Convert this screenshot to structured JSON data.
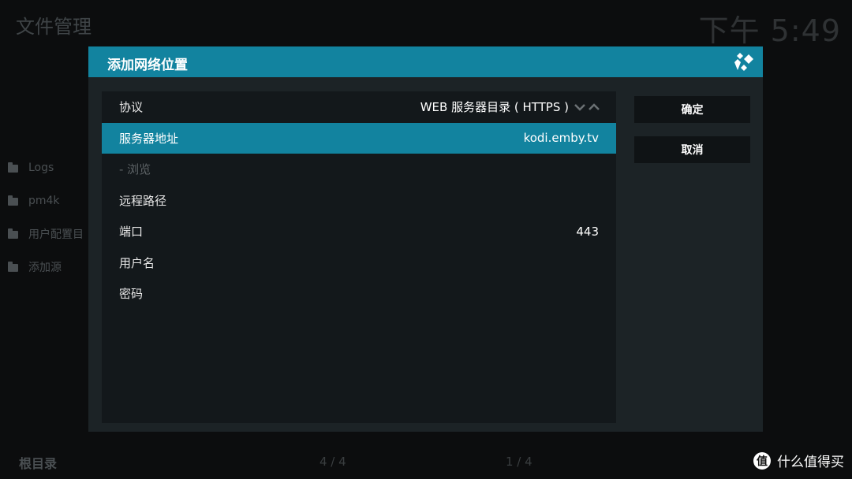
{
  "background": {
    "title": "文件管理",
    "clock": "下午 5:49",
    "sources": [
      {
        "label": "Logs"
      },
      {
        "label": "pm4k"
      },
      {
        "label": "用户配置目"
      },
      {
        "label": "添加源"
      }
    ],
    "footer_left": "根目录",
    "count_left": "4 / 4",
    "count_right": "1 / 4"
  },
  "watermark": {
    "logo": "值",
    "text": "什么值得买"
  },
  "dialog": {
    "title": "添加网络位置",
    "rows": [
      {
        "label": "协议",
        "value": "WEB 服务器目录 ( HTTPS )"
      },
      {
        "label": "服务器地址",
        "value": "kodi.emby.tv"
      },
      {
        "label": "- 浏览",
        "value": ""
      },
      {
        "label": "远程路径",
        "value": ""
      },
      {
        "label": "端口",
        "value": "443"
      },
      {
        "label": "用户名",
        "value": ""
      },
      {
        "label": "密码",
        "value": ""
      }
    ],
    "ok_label": "确定",
    "cancel_label": "取消"
  },
  "colors": {
    "accent": "#12839f",
    "dialog_bg": "#1c2326",
    "panel_bg": "#13181b"
  },
  "icons": {
    "header": "kodi-logo-icon",
    "spinner_down": "chevron-down-icon",
    "spinner_up": "chevron-up-icon",
    "folder": "folder-icon"
  }
}
